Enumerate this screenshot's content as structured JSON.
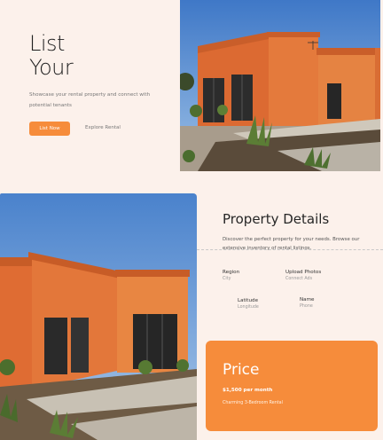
{
  "hero": {
    "title_line1": "List",
    "title_line2": "Your",
    "description": "Showcase your rental property and connect with potential tenants",
    "primary_button": "List Now",
    "secondary_link": "Explore Rental"
  },
  "details": {
    "title": "Property Details",
    "description": "Discover the perfect property for your needs. Browse our extensive inventory of rental listings.",
    "fields": [
      {
        "label": "Region",
        "value": "City"
      },
      {
        "label": "Upload Photos",
        "value": "Connect Ads"
      },
      {
        "label": "Latitude",
        "value": "Longitude"
      },
      {
        "label": "Name",
        "value": "Phone"
      }
    ]
  },
  "price": {
    "title": "Price",
    "amount": "$1,500 per month",
    "description": "Charming 3-Bedroom Rental"
  },
  "colors": {
    "accent": "#f68c3b",
    "background": "#fcf1eb",
    "house_orange": "#e37339",
    "sky": "#5d8fd0"
  },
  "images": {
    "top": "house-photo",
    "bottom": "house-photo"
  }
}
